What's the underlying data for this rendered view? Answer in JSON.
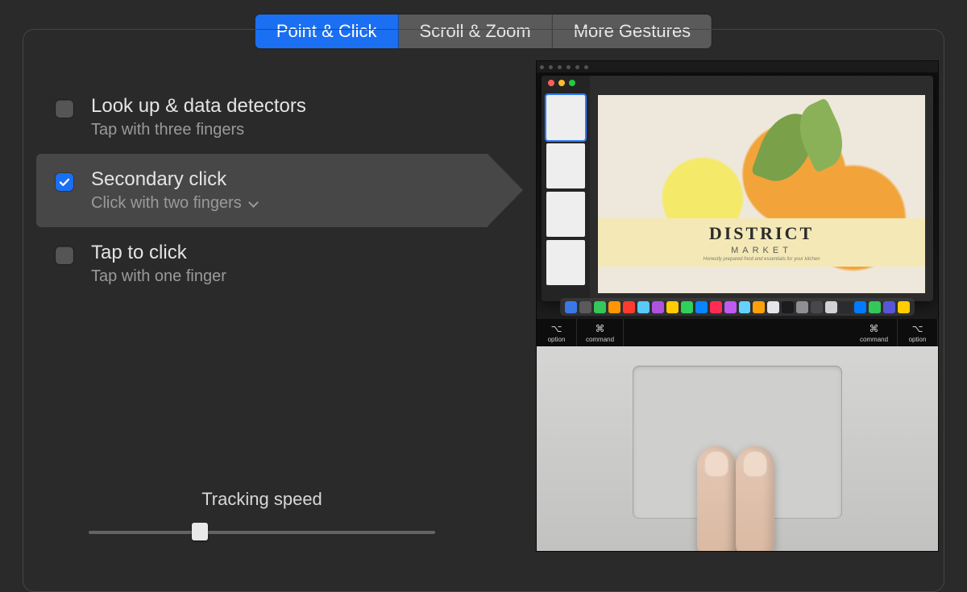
{
  "tabs": {
    "point_click": "Point & Click",
    "scroll_zoom": "Scroll & Zoom",
    "more_gestures": "More Gestures"
  },
  "options": {
    "lookup": {
      "title": "Look up & data detectors",
      "subtitle": "Tap with three fingers",
      "checked": false
    },
    "secondary": {
      "title": "Secondary click",
      "subtitle": "Click with two fingers",
      "checked": true
    },
    "tap_click": {
      "title": "Tap to click",
      "subtitle": "Tap with one finger",
      "checked": false
    }
  },
  "tracking": {
    "label": "Tracking speed",
    "value_percent": 32
  },
  "preview": {
    "poster_title": "DISTRICT",
    "poster_sub": "MARKET",
    "poster_tagline": "Honestly prepared food and essentials for your kitchen",
    "touchbar": {
      "left1": "option",
      "left2": "command",
      "right2": "command",
      "right1": "option",
      "symbol": "⌘"
    }
  },
  "colors": {
    "accent": "#1a6ff2",
    "panel": "#2a2a2a",
    "row_selected": "#474747"
  }
}
